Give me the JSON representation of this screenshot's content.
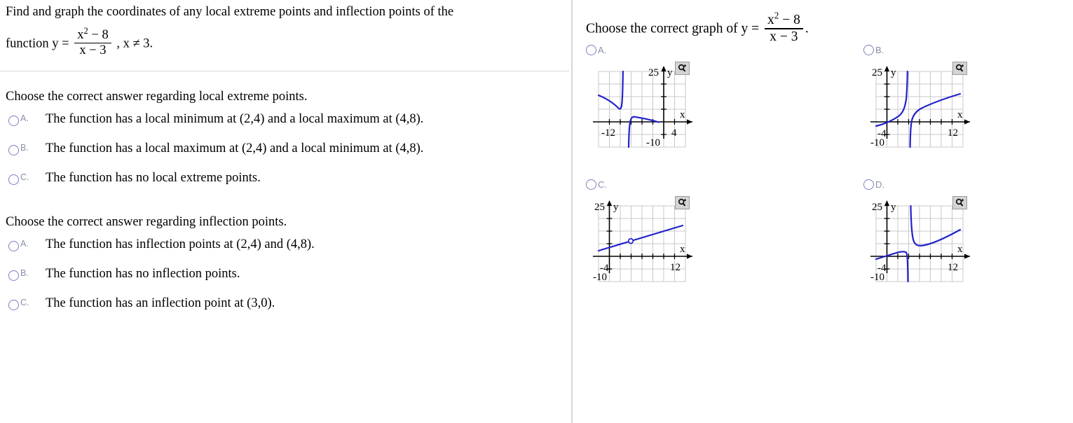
{
  "problem": {
    "line1": "Find and graph the coordinates of any local extreme points and inflection points of the",
    "line2_prefix": "function y =",
    "numerator": "x",
    "numerator_exp": "2",
    "numerator_rest": "− 8",
    "denominator": "x − 3",
    "line2_suffix": ", x ≠ 3."
  },
  "question1": {
    "heading": "Choose the correct answer regarding local extreme points.",
    "options": [
      {
        "letter": "A.",
        "text": "The function has a local minimum at (2,4) and a local maximum at (4,8)."
      },
      {
        "letter": "B.",
        "text": "The function has a local maximum at (2,4) and a local minimum at (4,8)."
      },
      {
        "letter": "C.",
        "text": "The function has no local extreme points."
      }
    ]
  },
  "question2": {
    "heading": "Choose the correct answer regarding inflection points.",
    "options": [
      {
        "letter": "A.",
        "text": "The function has inflection points at (2,4) and (4,8)."
      },
      {
        "letter": "B.",
        "text": "The function has no inflection points."
      },
      {
        "letter": "C.",
        "text": "The function has an inflection point at (3,0)."
      }
    ]
  },
  "graph_panel": {
    "prompt_prefix": "Choose the correct graph of y =",
    "prompt_numerator": "x",
    "prompt_numerator_exp": "2",
    "prompt_numerator_rest": "− 8",
    "prompt_denominator": "x − 3",
    "prompt_suffix": ".",
    "zoom_icon": "magnifier-plus-icon",
    "zoom_title": "Enlarge graph",
    "curve_color": "#2222cc",
    "grid_color": "#c8c8c8",
    "axis_color": "#000000",
    "options": [
      {
        "letter": "A.",
        "x_left_label": "-12",
        "x_right_label": "4",
        "y_top_label": "25",
        "y_bottom_label": "-10",
        "x_axis_label": "x",
        "y_axis_label": "y"
      },
      {
        "letter": "B.",
        "x_left_label": "-4",
        "x_right_label": "12",
        "y_top_label": "25",
        "y_bottom_label": "-10",
        "x_axis_label": "x",
        "y_axis_label": "y"
      },
      {
        "letter": "C.",
        "x_left_label": "-4",
        "x_right_label": "12",
        "y_top_label": "25",
        "y_bottom_label": "-10",
        "x_axis_label": "x",
        "y_axis_label": "y"
      },
      {
        "letter": "D.",
        "x_left_label": "-4",
        "x_right_label": "12",
        "y_top_label": "25",
        "y_bottom_label": "-10",
        "x_axis_label": "x",
        "y_axis_label": "y"
      }
    ]
  },
  "chart_data": [
    {
      "id": "graph-A",
      "type": "line",
      "title": "Option A",
      "xlabel": "x",
      "ylabel": "y",
      "xlim": [
        -12,
        4
      ],
      "ylim": [
        -10,
        25
      ],
      "grid": true,
      "description": "Mirror image of (x^2-8)/(x-3): decreasing branches with vertical asymptote near x = -3; left branch falls from upper-left to a local minimum then rises steeply to +25; right branch comes up from -10, turns at a local maximum just right of the asymptote and falls toward the right.",
      "vertical_asymptote": -3,
      "series": [
        {
          "name": "left-branch",
          "x": [
            -12,
            -11,
            -10,
            -9,
            -8,
            -7,
            -6,
            -5,
            -4.4,
            -4.0,
            -3.7,
            -3.5,
            -3.35,
            -3.25,
            -3.2
          ],
          "y": [
            16.0,
            14.6,
            13.2,
            11.8,
            10.5,
            9.3,
            8.2,
            7.4,
            7.1,
            7.0,
            7.3,
            8.2,
            10.0,
            15.0,
            25.0
          ]
        },
        {
          "name": "right-branch",
          "x": [
            -2.85,
            -2.8,
            -2.7,
            -2.6,
            -2.4,
            -2.0,
            -1.5,
            -1.0,
            0.0,
            1.0,
            2.0,
            3.0,
            4.0
          ],
          "y": [
            -10.0,
            -6.0,
            -1.0,
            1.3,
            2.4,
            2.6,
            2.4,
            2.1,
            1.4,
            0.7,
            0.0,
            -0.7,
            -1.4
          ]
        }
      ]
    },
    {
      "id": "graph-B",
      "type": "line",
      "title": "Option B",
      "xlabel": "x",
      "ylabel": "y",
      "xlim": [
        -4,
        12
      ],
      "ylim": [
        -10,
        25
      ],
      "grid": true,
      "description": "Increasing S-shaped curve with vertical asymptote at x = 3; left branch rises from lower-left up to +25, right branch rises from -10 and continues increasing to the upper right.",
      "vertical_asymptote": 3,
      "series": [
        {
          "name": "left-branch",
          "x": [
            -4,
            -3,
            -2,
            -1,
            0,
            0.6,
            1.0,
            1.4,
            1.7,
            1.9,
            2.0,
            2.05
          ],
          "y": [
            -1.5,
            -0.5,
            0.6,
            1.8,
            3.2,
            4.4,
            5.6,
            7.6,
            10.5,
            15.0,
            20.0,
            25.0
          ]
        },
        {
          "name": "right-branch",
          "x": [
            2.3,
            2.4,
            2.6,
            2.9,
            3.3,
            4.0,
            5.0,
            6.0,
            7.5,
            9.0,
            10.5,
            12.0
          ],
          "y": [
            -10.0,
            -6.0,
            -2.0,
            0.8,
            2.6,
            4.2,
            5.6,
            6.6,
            8.0,
            9.3,
            10.6,
            11.8
          ]
        }
      ]
    },
    {
      "id": "graph-C",
      "type": "line",
      "title": "Option C",
      "xlabel": "x",
      "ylabel": "y",
      "xlim": [
        -4,
        12
      ],
      "ylim": [
        -10,
        25
      ],
      "grid": true,
      "description": "A single straight line of positive slope with a removable discontinuity (open circle) at approximately x = 3, y = 6.",
      "hole": {
        "x": 3,
        "y": 6.2
      },
      "series": [
        {
          "name": "line",
          "x": [
            -4,
            12
          ],
          "y": [
            1.5,
            14.5
          ]
        }
      ]
    },
    {
      "id": "graph-D",
      "type": "line",
      "title": "Option D",
      "xlabel": "x",
      "ylabel": "y",
      "xlim": [
        -4,
        12
      ],
      "ylim": [
        -10,
        25
      ],
      "grid": true,
      "description": "Graph of (x^2-8)/(x-3): left branch rises to a local maximum near x = 1 then plunges to -10 at the asymptote x = 3; right branch drops from +25, reaches a local minimum near x = 5 and then rises steadily to the upper right.",
      "vertical_asymptote": 3,
      "series": [
        {
          "name": "left-branch",
          "x": [
            -4,
            -3,
            -2,
            -1,
            0,
            0.6,
            1.0,
            1.4,
            1.8,
            2.1,
            2.3,
            2.4,
            2.45
          ],
          "y": [
            -0.8,
            -0.1,
            0.6,
            1.3,
            1.9,
            2.2,
            2.3,
            2.2,
            1.8,
            0.9,
            -1.5,
            -5.0,
            -10.0
          ]
        },
        {
          "name": "right-branch",
          "x": [
            2.9,
            3.0,
            3.15,
            3.4,
            3.8,
            4.4,
            5.0,
            6.0,
            7.5,
            9.0,
            10.5,
            12.0
          ],
          "y": [
            25.0,
            18.0,
            12.5,
            8.8,
            6.9,
            6.1,
            6.0,
            6.4,
            7.6,
            9.0,
            10.5,
            12.0
          ]
        }
      ]
    }
  ]
}
